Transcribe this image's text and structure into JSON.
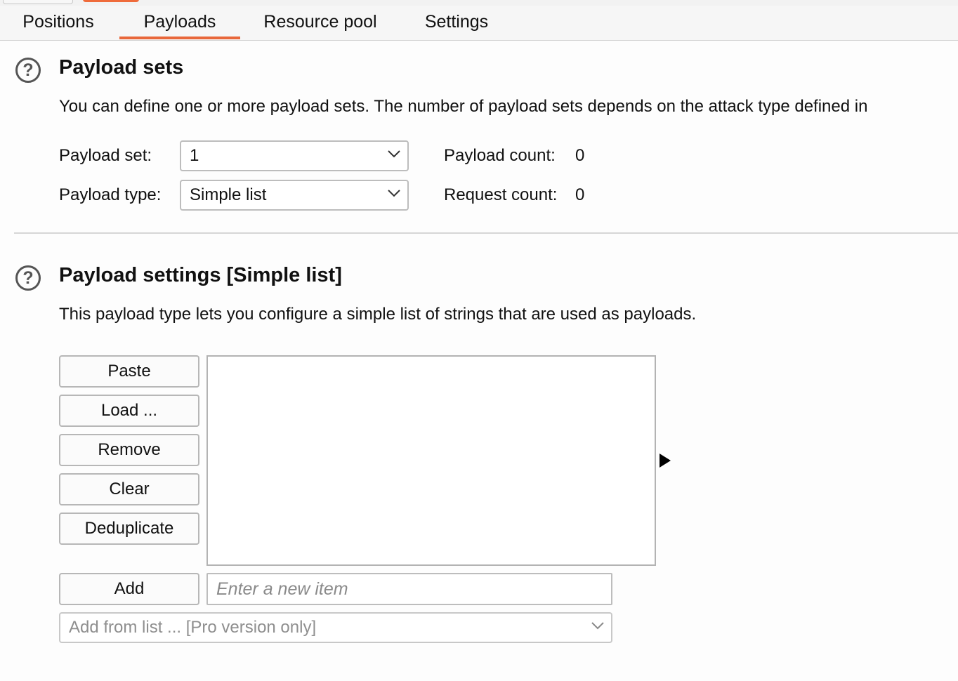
{
  "tabs": [
    {
      "label": "Positions",
      "active": false
    },
    {
      "label": "Payloads",
      "active": true
    },
    {
      "label": "Resource pool",
      "active": false
    },
    {
      "label": "Settings",
      "active": false
    }
  ],
  "accent_color": "#e8673a",
  "help_icon_glyph": "?",
  "payload_sets": {
    "title": "Payload sets",
    "description": "You can define one or more payload sets. The number of payload sets depends on the attack type defined in",
    "payload_set_label": "Payload set:",
    "payload_set_value": "1",
    "payload_type_label": "Payload type:",
    "payload_type_value": "Simple list",
    "payload_count_label": "Payload count:",
    "payload_count_value": "0",
    "request_count_label": "Request count:",
    "request_count_value": "0"
  },
  "payload_settings": {
    "title": "Payload settings [Simple list]",
    "description": "This payload type lets you configure a simple list of strings that are used as payloads.",
    "buttons": {
      "paste": "Paste",
      "load": "Load ...",
      "remove": "Remove",
      "clear": "Clear",
      "deduplicate": "Deduplicate",
      "add": "Add"
    },
    "list_items": [],
    "new_item_placeholder": "Enter a new item",
    "add_from_list": "Add from list ... [Pro version only]"
  }
}
